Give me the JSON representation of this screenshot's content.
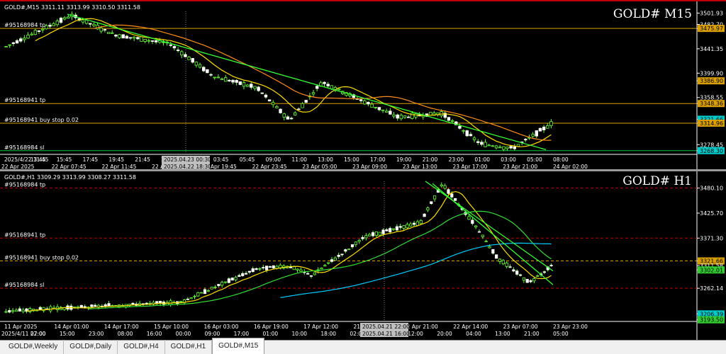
{
  "tabs": [
    "GOLD#,Weekly",
    "GOLD#,Daily",
    "GOLD#,H4",
    "GOLD#,H1",
    "GOLD#,M15"
  ],
  "active_tab": "GOLD#,M15",
  "top": {
    "ohlc": "GOLD#,M15  3311.11 3313.99 3310.50 3311.58",
    "big_label": "GOLD# M15",
    "hlines": [
      {
        "label": "#95168984 tp",
        "color": "#d9a000",
        "price": 3475.97
      },
      {
        "label": "#95168941 tp",
        "color": "#d9a000",
        "price": 3348.36
      },
      {
        "label": "#95168941 buy stop 0.02",
        "color": "#d9a000",
        "price": 3314.96
      },
      {
        "label": "#95168984 sl",
        "color": "#00cc44",
        "price": 3268.3
      }
    ],
    "price_ticks": [
      "3501.93",
      "3482.70",
      "3475.97",
      "3441.35",
      "3399.90",
      "3386.90",
      "3358.55",
      "3348.36",
      "3321.66",
      "3314.96",
      "3278.45",
      "3268.30"
    ],
    "time_ticks": [
      "2025/4/22 11:45",
      "13:45",
      "15:45",
      "17:45",
      "19:45",
      "21:45",
      "23:45",
      "01:45",
      "03:45",
      "05:45",
      "09:00",
      "11:00",
      "13:00",
      "15:00",
      "17:00",
      "19:00",
      "21:00",
      "23:00",
      "01:00",
      "03:00",
      "05:00",
      "08:00"
    ],
    "time_ticks2": [
      "22 Apr 2025",
      "22 Apr 07:45",
      "22 Apr 11:45",
      "22 A",
      "22 Apr 19:45",
      "22 Apr 23:45",
      "23 Apr 05:00",
      "23 Apr 09:00",
      "23 Apr 13:00",
      "23 Apr 17:00",
      "23 Apr 21:00",
      "24 Apr 02:00"
    ],
    "crosshair_time": "2025.04.23 00:30",
    "crosshair_time2": "2025.04.22 18:30"
  },
  "bottom": {
    "ohlc": "GOLD#,H1  3309.29 3313.99 3308.27 3311.58",
    "big_label": "GOLD# H1",
    "hlines": [
      {
        "label": "#95168984 tp",
        "color": "#c00000",
        "price": 3480.1
      },
      {
        "label": "#95168941 tp",
        "color": "#c00000",
        "price": 3371.3
      },
      {
        "label": "#95168941 buy stop 0.02",
        "color": "#d9a000",
        "price": 3321.66
      },
      {
        "label": "#95168984 sl",
        "color": "#c00000",
        "price": 3262.14
      }
    ],
    "price_ticks": [
      "3480.10",
      "3425.70",
      "3371.30",
      "3321.66",
      "3311.58",
      "3302.01",
      "3262.14",
      "3206.39",
      "3193.50"
    ],
    "time_ticks": [
      "11 Apr 2025",
      "14 Apr 01:00",
      "14 Apr 17:00",
      "15 Apr 10:00",
      "16 Apr 03:00",
      "16 Apr 19:00",
      "17 Apr 12:00",
      "21 A",
      "22 Apr 21:00",
      "22 Apr 14:00",
      "23 Apr 07:00",
      "23 Apr 23:00"
    ],
    "time_ticks2": [
      "2025/4/11 22:00",
      "07:00",
      "15:00",
      "23:00",
      "08:00",
      "16:00",
      "00:00",
      "09:00",
      "17:00",
      "01:00",
      "10:00",
      "18:00",
      "02:00",
      "11:0",
      "12:00",
      "20:00",
      "04:00",
      "13:00",
      "21:00",
      "05:00"
    ],
    "crosshair_time": "2025.04.21 22:00",
    "crosshair_time2": "2025.04.21 16:00"
  }
}
